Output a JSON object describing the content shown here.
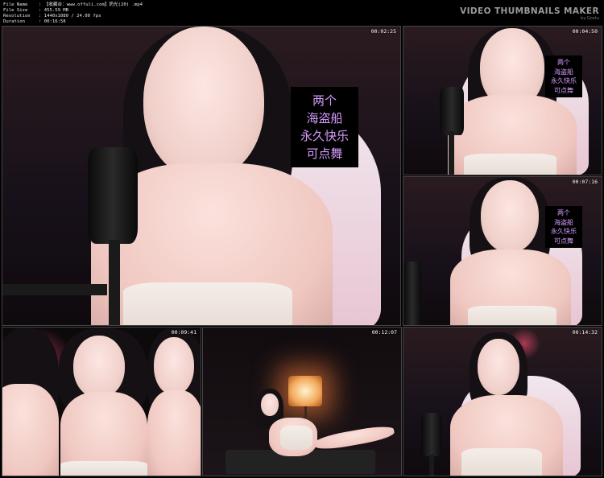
{
  "header": {
    "fields": [
      {
        "key": "File Name",
        "value": ": 【收藏台：www.offuli.com】奶光(20) .mp4"
      },
      {
        "key": "File Size",
        "value": ": 455.59 MB"
      },
      {
        "key": "Resolution",
        "value": ": 1440x1080 / 24.00 fps"
      },
      {
        "key": "Duration",
        "value": ": 00:16:58"
      }
    ],
    "brand_title": "VIDEO THUMBNAILS MAKER",
    "brand_sub": "by Gootu"
  },
  "thumbnails": [
    {
      "timestamp": "00:02:25",
      "caption": [
        "两个",
        "海盗船",
        "永久快乐",
        "可点舞"
      ]
    },
    {
      "timestamp": "00:04:50",
      "caption": [
        "两个",
        "海盗船",
        "永久快乐",
        "可点舞"
      ]
    },
    {
      "timestamp": "00:07:16",
      "caption": [
        "两个",
        "海盗船",
        "永久快乐",
        "可点舞"
      ]
    },
    {
      "timestamp": "00:09:41"
    },
    {
      "timestamp": "00:12:07"
    },
    {
      "timestamp": "00:14:32"
    }
  ]
}
